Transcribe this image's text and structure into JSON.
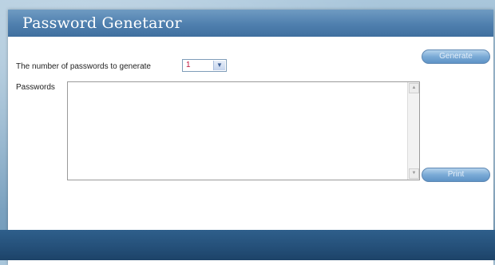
{
  "window": {
    "title": "Password Genetaror"
  },
  "controls": {
    "count_label": "The number of passwords to generate",
    "count_value": "1",
    "generate_label": "Generate",
    "passwords_label": "Passwords",
    "print_label": "Print"
  },
  "colors": {
    "title_bar": "#4f7fae",
    "button": "#7aaad6",
    "footer": "#244f78",
    "select_value": "#c0143c"
  }
}
